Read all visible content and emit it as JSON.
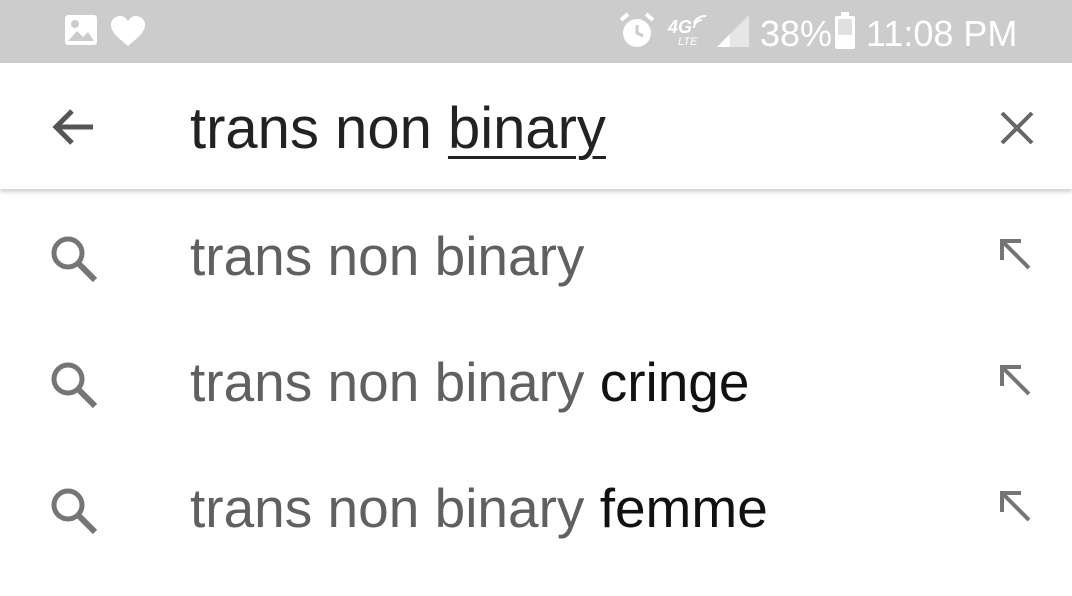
{
  "status_bar": {
    "icons": [
      "gallery-icon",
      "heart-icon",
      "alarm-icon",
      "4g-lte-icon",
      "signal-icon",
      "battery-icon"
    ],
    "network_label": "4G",
    "network_sublabel": "LTE",
    "battery_percent": "38%",
    "time": "11:08 PM"
  },
  "search": {
    "query_prefix": "trans non ",
    "query_composing": "binary",
    "back_icon": "arrow-left-icon",
    "clear_icon": "close-icon"
  },
  "suggestions": [
    {
      "base": "trans non binary",
      "completion": ""
    },
    {
      "base": "trans non binary ",
      "completion": "cringe"
    },
    {
      "base": "trans non binary ",
      "completion": "femme"
    }
  ],
  "colors": {
    "status_bar_bg": "#cccccc",
    "query_text": "#222222",
    "suggestion_text": "#606060",
    "suggestion_bold": "#111111",
    "icon_gray": "#757575"
  }
}
